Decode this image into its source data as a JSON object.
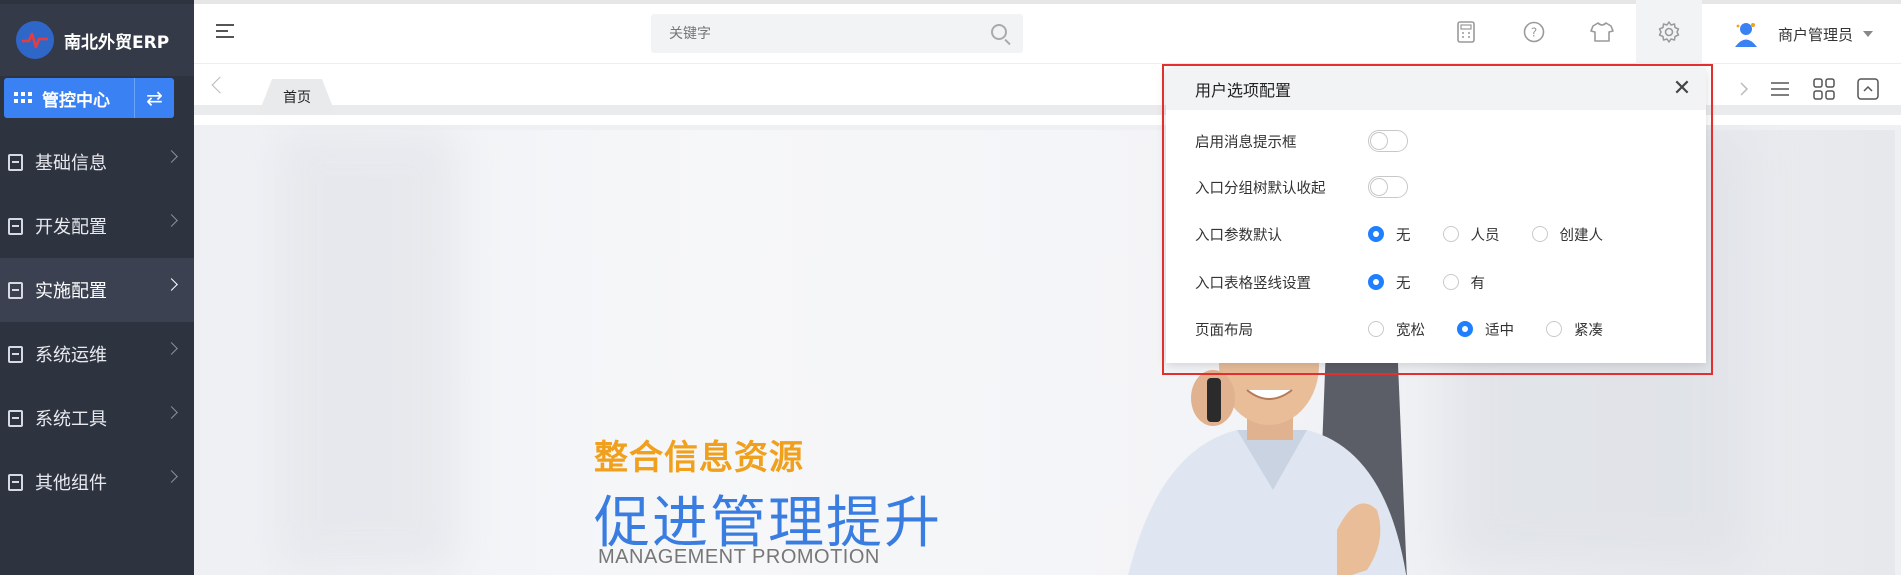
{
  "app": {
    "name": "南北外贸ERP",
    "control_center": "管控中心"
  },
  "sidebar": {
    "items": [
      {
        "label": "基础信息",
        "active": false
      },
      {
        "label": "开发配置",
        "active": false
      },
      {
        "label": "实施配置",
        "active": true
      },
      {
        "label": "系统运维",
        "active": false
      },
      {
        "label": "系统工具",
        "active": false
      },
      {
        "label": "其他组件",
        "active": false
      }
    ]
  },
  "header": {
    "search_placeholder": "关键字",
    "user_name": "商户管理员",
    "icons": [
      "calculator-icon",
      "help-icon",
      "theme-shirt-icon",
      "settings-gear-icon"
    ]
  },
  "tabs": {
    "items": [
      {
        "label": "首页",
        "active": true
      }
    ],
    "right_icons": [
      "chevron-right-icon",
      "list-icon",
      "grid-icon",
      "collapse-icon"
    ]
  },
  "banner": {
    "line1": "整合信息资源",
    "line2": "促进管理提升",
    "line3": "MANAGEMENT PROMOTION"
  },
  "settings_panel": {
    "title": "用户选项配置",
    "options": [
      {
        "label": "启用消息提示框",
        "type": "toggle",
        "value": false
      },
      {
        "label": "入口分组树默认收起",
        "type": "toggle",
        "value": false
      },
      {
        "label": "入口参数默认",
        "type": "radio",
        "choices": [
          "无",
          "人员",
          "创建人"
        ],
        "selected": "无"
      },
      {
        "label": "入口表格竖线设置",
        "type": "radio",
        "choices": [
          "无",
          "有"
        ],
        "selected": "无"
      },
      {
        "label": "页面布局",
        "type": "radio",
        "choices": [
          "宽松",
          "适中",
          "紧凑"
        ],
        "selected": "适中"
      }
    ]
  },
  "colors": {
    "sidebar_bg": "#2e3340",
    "accent": "#3a82f4",
    "radio_selected": "#1e80ff",
    "highlight_border": "#e2302f",
    "slogan_orange": "#f0a01c",
    "slogan_blue": "#3a7de0"
  }
}
